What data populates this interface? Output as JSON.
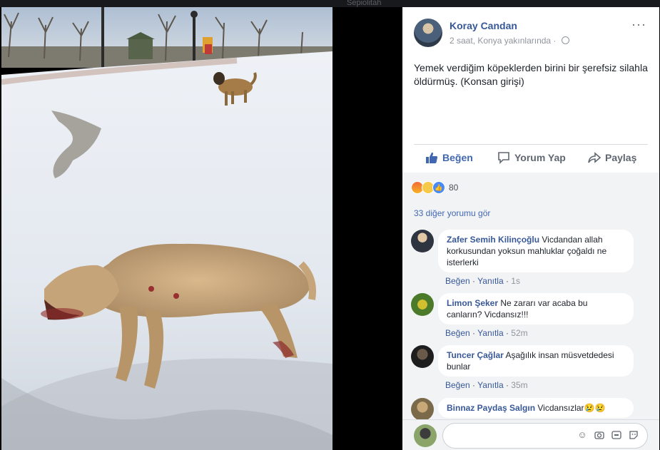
{
  "topbar": {
    "ghost_text": "Sepiolitah"
  },
  "post": {
    "author": "Koray Candan",
    "meta": "2 saat, Konya yakınlarında ·",
    "text": "Yemek verdiğim köpeklerden birini bir şerefsiz silahla öldürmüş. (Konsan girişi)",
    "more_label": "···"
  },
  "actions": {
    "like": "Beğen",
    "comment": "Yorum Yap",
    "share": "Paylaş"
  },
  "reactions": {
    "count": "80",
    "types": [
      "angry",
      "sad",
      "like"
    ]
  },
  "more_comments": "33 diğer yorumu gör",
  "comment_actions": {
    "like": "Beğen",
    "reply": "Yanıtla"
  },
  "comments": [
    {
      "name": "Zafer Semih Kilinçoğlu",
      "text": "Vicdandan allah korkusundan yoksun mahluklar çoğaldı ne isterlerki",
      "time": "1s"
    },
    {
      "name": "Limon Şeker",
      "text": "Ne zararı var acaba bu canların? Vicdansız!!!",
      "time": "52m"
    },
    {
      "name": "Tuncer Çağlar",
      "text": "Aşağılık insan müsvetdedesi bunlar",
      "time": "35m"
    },
    {
      "name": "Binnaz Paydaş Salgın",
      "text": "Vicdansızlar😢😢",
      "time": ""
    }
  ],
  "icons": {
    "like": "thumbs-up-icon",
    "comment": "comment-icon",
    "share": "share-icon",
    "emoji": "emoji-icon",
    "camera": "camera-icon",
    "gif": "gif-icon",
    "sticker": "sticker-icon"
  }
}
